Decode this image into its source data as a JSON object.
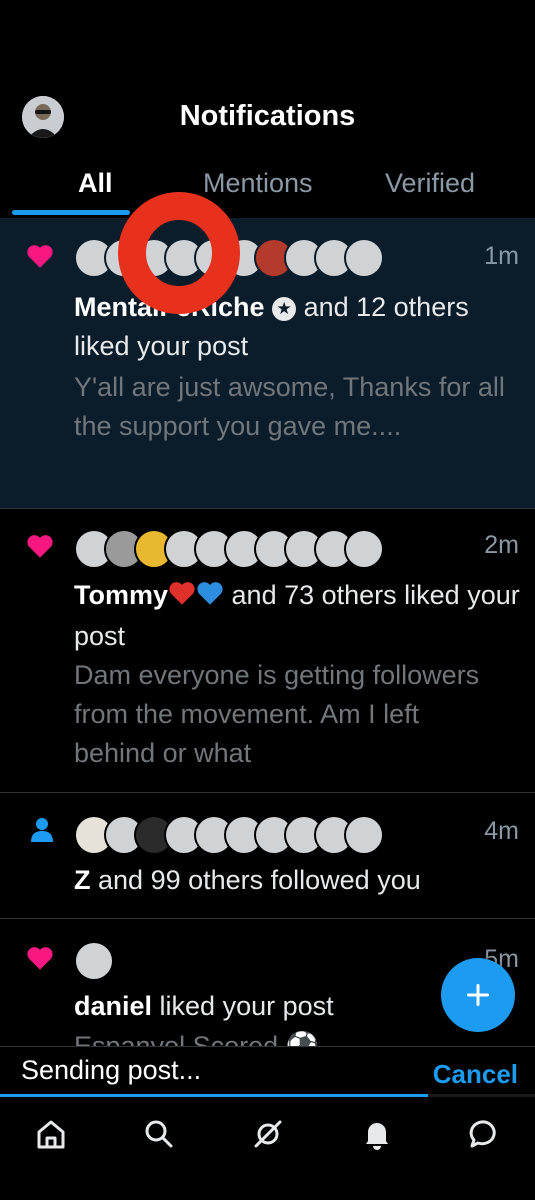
{
  "header": {
    "title": "Notifications",
    "tabs": [
      {
        "label": "All",
        "active": true
      },
      {
        "label": "Mentions",
        "active": false
      },
      {
        "label": "Verified",
        "active": false
      }
    ]
  },
  "notifications": [
    {
      "type": "like",
      "icon": "heart-icon",
      "time": "1m",
      "name": "MentalFeRiche",
      "verified_badge_icon": "star-badge-icon",
      "action": "and 12 others liked your post",
      "snippet": "Y'all are just awsome, Thanks for all the support you gave me....",
      "unread": true
    },
    {
      "type": "like",
      "icon": "heart-icon",
      "time": "2m",
      "name": "Tommy",
      "name_emojis": [
        "red-heart",
        "blue-heart"
      ],
      "action": "and 73 others liked your post",
      "snippet": "Dam everyone is getting followers from the movement. Am I left behind or what"
    },
    {
      "type": "follow",
      "icon": "person-icon",
      "time": "4m",
      "name": "Z",
      "action": "and 99 others followed you"
    },
    {
      "type": "like",
      "icon": "heart-icon",
      "time": "5m",
      "name": "daniel",
      "action": "liked your post",
      "snippet": "Espanyol Scored ⚽"
    }
  ],
  "upload": {
    "status": "Sending post...",
    "cancel_label": "Cancel",
    "progress": 0.8
  },
  "bottom_nav": [
    "home-icon",
    "search-icon",
    "grok-icon",
    "notifications-bell-icon",
    "messages-icon"
  ],
  "colors": {
    "accent": "#1d9bf0",
    "like": "#f91880",
    "unread_bg": "#0b1d2b",
    "overlay_ring": "#e8311d"
  }
}
